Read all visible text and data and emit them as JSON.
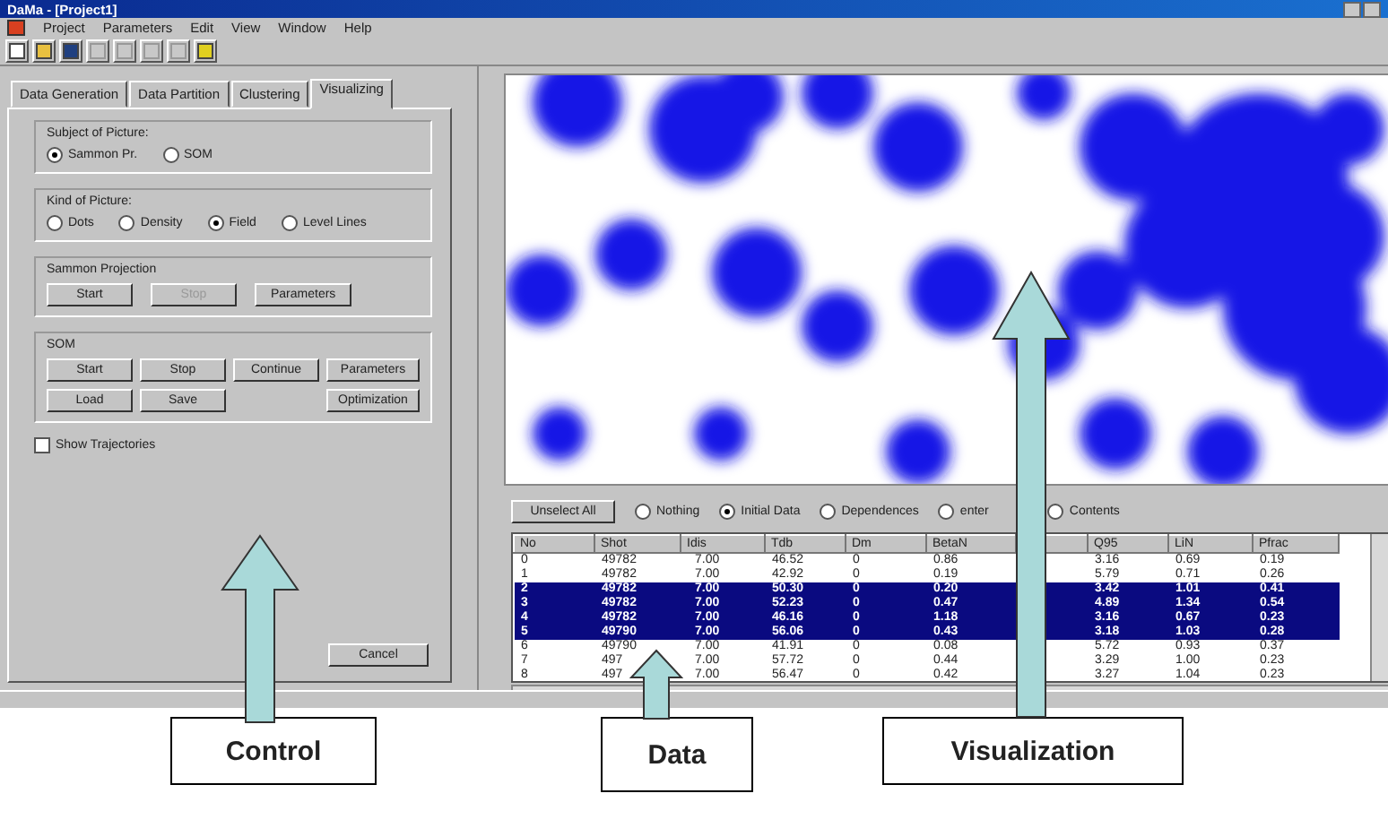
{
  "window": {
    "title": "DaMa - [Project1]"
  },
  "menu": [
    "Project",
    "Parameters",
    "Edit",
    "View",
    "Window",
    "Help"
  ],
  "toolbar": [
    {
      "kind": "new",
      "disabled": false
    },
    {
      "kind": "open",
      "disabled": false
    },
    {
      "kind": "save",
      "disabled": false
    },
    {
      "kind": "cut",
      "disabled": true
    },
    {
      "kind": "copy",
      "disabled": true
    },
    {
      "kind": "paste",
      "disabled": true
    },
    {
      "kind": "print",
      "disabled": true
    },
    {
      "kind": "help",
      "disabled": false
    }
  ],
  "tabs": [
    {
      "label": "Data Generation",
      "selected": false
    },
    {
      "label": "Data Partition",
      "selected": false
    },
    {
      "label": "Clustering",
      "selected": false
    },
    {
      "label": "Visualizing",
      "selected": true
    }
  ],
  "subject_group": {
    "title": "Subject of Picture:",
    "options": [
      {
        "label": "Sammon Pr.",
        "selected": true
      },
      {
        "label": "SOM",
        "selected": false
      }
    ]
  },
  "kind_group": {
    "title": "Kind of Picture:",
    "options": [
      {
        "label": "Dots",
        "selected": false
      },
      {
        "label": "Density",
        "selected": false
      },
      {
        "label": "Field",
        "selected": true
      },
      {
        "label": "Level Lines",
        "selected": false
      }
    ]
  },
  "sammon_group": {
    "title": "Sammon Projection",
    "buttons": [
      {
        "label": "Start",
        "disabled": false
      },
      {
        "label": "Stop",
        "disabled": true
      },
      {
        "label": "Parameters",
        "disabled": false
      }
    ]
  },
  "som_group": {
    "title": "SOM",
    "rows": [
      [
        {
          "label": "Start"
        },
        {
          "label": "Stop"
        },
        {
          "label": "Continue"
        },
        {
          "label": "Parameters"
        }
      ],
      [
        {
          "label": "Load"
        },
        {
          "label": "Save"
        },
        null,
        {
          "label": "Optimization"
        }
      ]
    ]
  },
  "show_trajectories": {
    "label": "Show Trajectories",
    "checked": false
  },
  "bottom_buttons": [
    "Cancel"
  ],
  "data_panel": {
    "unselect_button": "Unselect All",
    "options": [
      {
        "label": "Nothing",
        "selected": false
      },
      {
        "label": "Initial Data",
        "selected": true
      },
      {
        "label": "Dependences",
        "selected": false
      },
      {
        "label": "enter",
        "selected": false
      },
      {
        "label": "Contents",
        "selected": false
      }
    ],
    "table": {
      "columns": [
        "No",
        "Shot",
        "Idis",
        "Tdb",
        "Dm",
        "BetaN",
        "Q95",
        "LiN",
        "Pfrac"
      ],
      "rows": [
        {
          "cells": [
            "0",
            "49782",
            "7.00",
            "46.52",
            "0",
            "0.86",
            "3.16",
            "0.69",
            "0.19"
          ],
          "selected": false
        },
        {
          "cells": [
            "1",
            "49782",
            "7.00",
            "42.92",
            "0",
            "0.19",
            "5.79",
            "0.71",
            "0.26"
          ],
          "selected": false
        },
        {
          "cells": [
            "2",
            "49782",
            "7.00",
            "50.30",
            "0",
            "0.20",
            "3.42",
            "1.01",
            "0.41"
          ],
          "selected": true
        },
        {
          "cells": [
            "3",
            "49782",
            "7.00",
            "52.23",
            "0",
            "0.47",
            "4.89",
            "1.34",
            "0.54"
          ],
          "selected": true
        },
        {
          "cells": [
            "4",
            "49782",
            "7.00",
            "46.16",
            "0",
            "1.18",
            "3.16",
            "0.67",
            "0.23"
          ],
          "selected": true
        },
        {
          "cells": [
            "5",
            "49790",
            "7.00",
            "56.06",
            "0",
            "0.43",
            "3.18",
            "1.03",
            "0.28"
          ],
          "selected": true
        },
        {
          "cells": [
            "6",
            "49790",
            "7.00",
            "41.91",
            "0",
            "0.08",
            "5.72",
            "0.93",
            "0.37"
          ],
          "selected": false
        },
        {
          "cells": [
            "7",
            "497",
            "7.00",
            "57.72",
            "0",
            "0.44",
            "3.29",
            "1.00",
            "0.23"
          ],
          "selected": false
        },
        {
          "cells": [
            "8",
            "497",
            "7.00",
            "56.47",
            "0",
            "0.42",
            "3.27",
            "1.04",
            "0.23"
          ],
          "selected": false
        }
      ]
    }
  },
  "callouts": [
    "Control",
    "Data",
    "Visualization"
  ]
}
